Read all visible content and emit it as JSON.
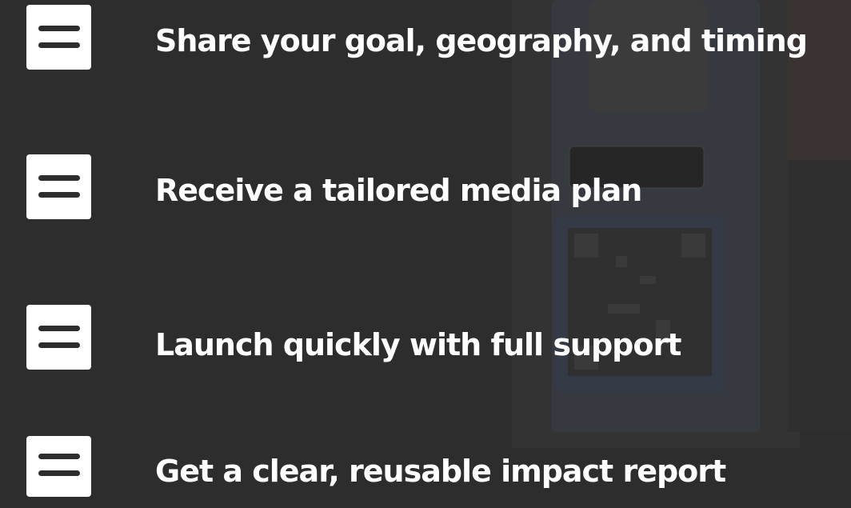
{
  "steps": [
    {
      "label": "Share your goal, geography, and timing",
      "icon": "menu-icon"
    },
    {
      "label": "Receive a tailored media plan",
      "icon": "menu-icon"
    },
    {
      "label": "Launch quickly with full support",
      "icon": "menu-icon"
    },
    {
      "label": "Get a clear, reusable impact report",
      "icon": "menu-icon"
    }
  ],
  "colors": {
    "background": "#2d2d2d",
    "icon_box": "#ffffff",
    "icon_lines": "#2d2d2d",
    "text": "#ffffff"
  }
}
